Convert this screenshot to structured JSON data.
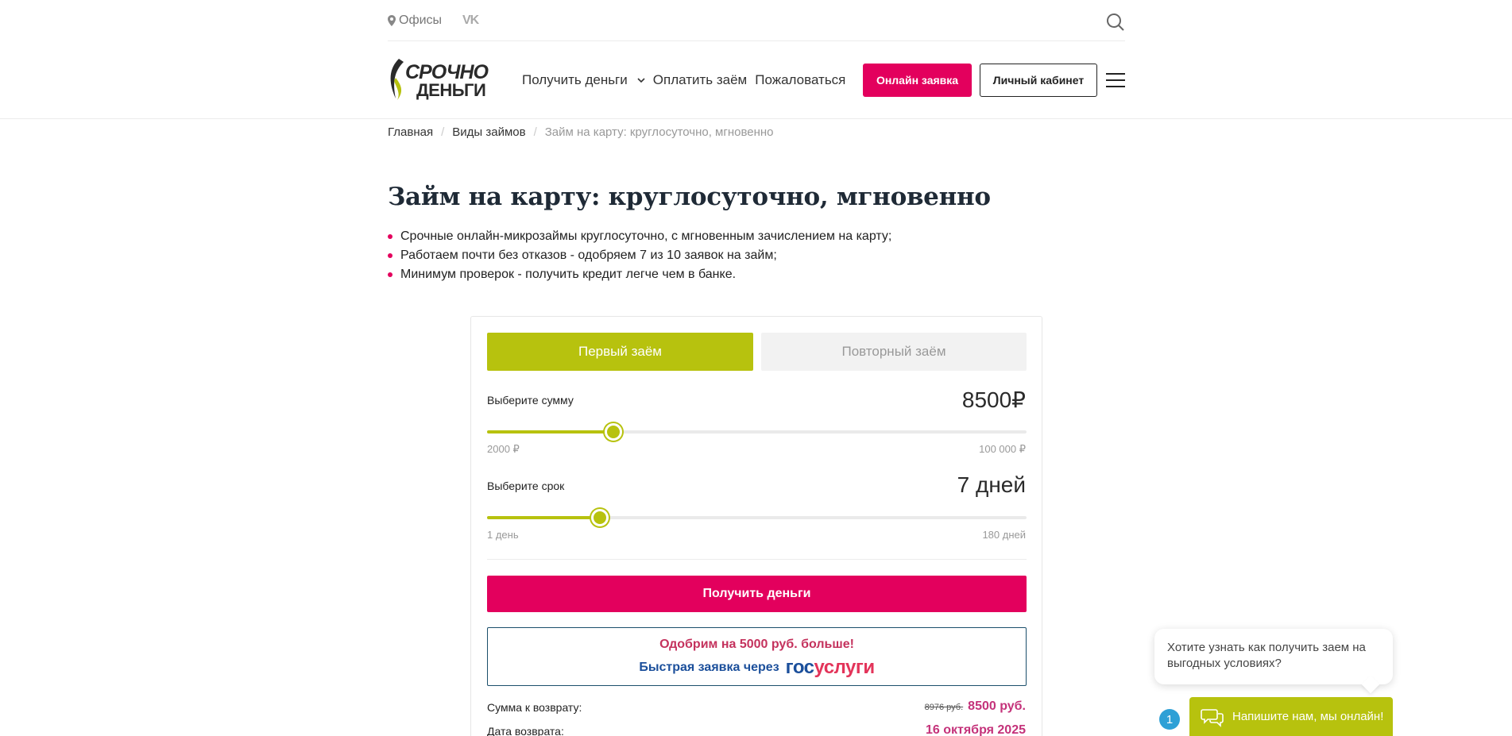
{
  "topbar": {
    "offices_label": "Офисы",
    "vk_label": "VK"
  },
  "header": {
    "logo_line1": "СРОЧНО",
    "logo_line2": "ДЕНЬГИ",
    "nav": [
      {
        "label": "Получить деньги"
      },
      {
        "label": "Оплатить заём"
      },
      {
        "label": "Пожаловаться"
      }
    ],
    "apply_button": "Онлайн заявка",
    "cabinet_button": "Личный кабинет"
  },
  "breadcrumb": {
    "home": "Главная",
    "section": "Виды займов",
    "current": "Займ на карту: круглосуточно, мгновенно"
  },
  "page": {
    "title": "Займ на карту: круглосуточно, мгновенно",
    "bullets": [
      "Срочные онлайн-микрозаймы круглосуточно, с мгновенным зачислением на карту;",
      "Работаем почти без отказов - одобряем 7 из 10 заявок на займ;",
      "Минимум проверок - получить кредит легче чем в банке."
    ]
  },
  "calculator": {
    "tab_first": "Первый заём",
    "tab_repeat": "Повторный заём",
    "sum": {
      "label": "Выберите сумму",
      "value": "8500₽",
      "min_label": "2000 ₽",
      "max_label": "100 000 ₽",
      "fraction": 0.2347
    },
    "term": {
      "label": "Выберите срок",
      "value": "7 дней",
      "min_label": "1 день",
      "max_label": "180 дней",
      "fraction": 0.2094
    },
    "get_money_button": "Получить деньги",
    "gosuslugi": {
      "line1": "Одобрим на 5000 руб. больше!",
      "line2": "Быстрая заявка через",
      "logo_part1": "гос",
      "logo_part2": "услуги"
    },
    "return_sum": {
      "label": "Сумма к возврату:",
      "old": "8976 руб.",
      "new": "8500 руб."
    },
    "return_date": {
      "label": "Дата возврата:",
      "value": "16 октября 2025"
    }
  },
  "chat": {
    "bubble_text": "Хотите узнать как получить заем на выгодных условиях?",
    "badge_count": "1",
    "button_label": "Напишите нам, мы онлайн!"
  },
  "colors": {
    "accent_green": "#b7c20e",
    "accent_pink": "#e3005d",
    "title_dark": "#1f2a36"
  }
}
